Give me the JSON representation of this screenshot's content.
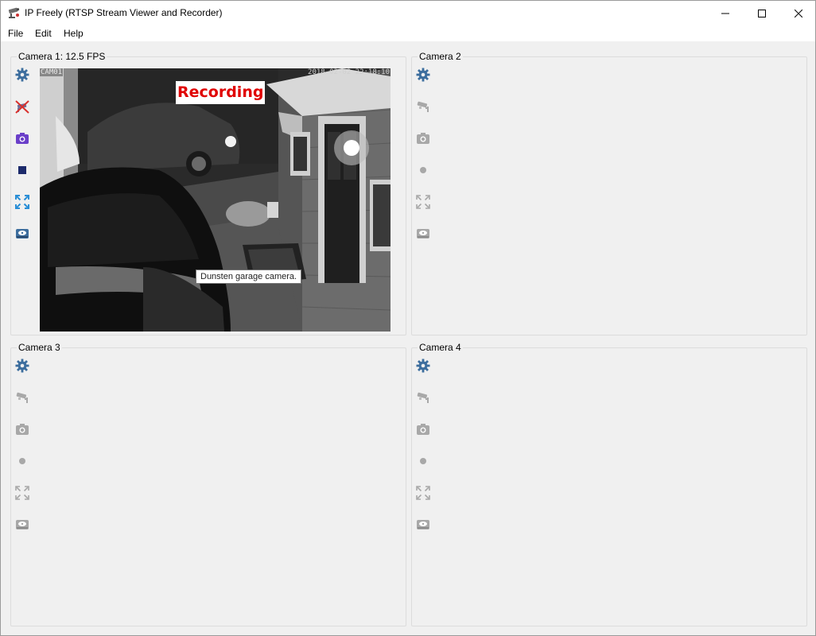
{
  "window": {
    "title": "IP Freely (RTSP Stream Viewer and Recorder)"
  },
  "menu": {
    "items": [
      "File",
      "Edit",
      "Help"
    ]
  },
  "cameras": [
    {
      "title": "Camera 1: 12.5 FPS",
      "active": true,
      "overlay": {
        "camera_tag": "CAM01",
        "timestamp": "2018-02-02 22:18:10",
        "recording_label": "Recording"
      },
      "tooltip": "Dunsten garage camera.",
      "tools": [
        "gear-icon",
        "camera-disconnect-icon",
        "snapshot-icon",
        "stop-record-icon",
        "fullscreen-icon",
        "drive-icon"
      ]
    },
    {
      "title": "Camera 2",
      "active": false,
      "tools": [
        "gear-icon",
        "cctv-icon",
        "snapshot-icon",
        "record-icon",
        "fullscreen-icon",
        "drive-icon"
      ]
    },
    {
      "title": "Camera 3",
      "active": false,
      "tools": [
        "gear-icon",
        "cctv-icon",
        "snapshot-icon",
        "record-icon",
        "fullscreen-icon",
        "drive-icon"
      ]
    },
    {
      "title": "Camera 4",
      "active": false,
      "tools": [
        "gear-icon",
        "cctv-icon",
        "snapshot-icon",
        "record-icon",
        "fullscreen-icon",
        "drive-icon"
      ]
    }
  ],
  "colors": {
    "active_icon": "#3d6e9e",
    "disabled_icon": "#a8a8a8",
    "recording_text": "#e00000",
    "snapshot_active": "#6a3fc9",
    "fullscreen_active": "#2b8fd6"
  }
}
